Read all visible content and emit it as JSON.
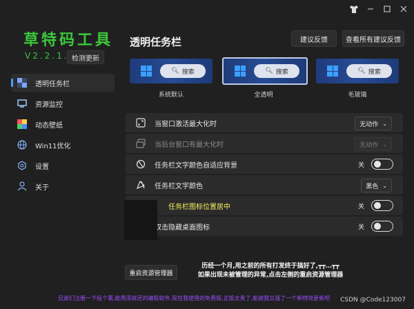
{
  "app": {
    "title": "草特码工具",
    "version": "V2.2.1.0",
    "update_button": "检测更新"
  },
  "sidebar": {
    "items": [
      {
        "label": "透明任务栏",
        "icon": "checker-icon",
        "active": true
      },
      {
        "label": "资源监控",
        "icon": "monitor-icon",
        "active": false
      },
      {
        "label": "动态壁纸",
        "icon": "wallpaper-icon",
        "active": false
      },
      {
        "label": "Win11优化",
        "icon": "globe-icon",
        "active": false
      },
      {
        "label": "设置",
        "icon": "gear-icon",
        "active": false
      },
      {
        "label": "关于",
        "icon": "user-icon",
        "active": false
      }
    ]
  },
  "header": {
    "page_title": "透明任务栏",
    "feedback_button": "建议反馈",
    "view_feedback_button": "查看所有建议反馈"
  },
  "previews": [
    {
      "label": "系统默认",
      "search": "搜索",
      "selected": false
    },
    {
      "label": "全透明",
      "search": "搜索",
      "selected": true
    },
    {
      "label": "毛玻璃",
      "search": "搜索",
      "selected": false
    }
  ],
  "settings": [
    {
      "label": "当窗口激活最大化时",
      "control": "dropdown",
      "value": "无动作",
      "disabled": false
    },
    {
      "label": "当后台窗口有最大化时",
      "control": "dropdown",
      "value": "无动作",
      "disabled": true
    },
    {
      "label": "任务栏文字颜色自适应背景",
      "control": "toggle",
      "value": "关",
      "disabled": false
    },
    {
      "label": "任务栏文字颜色",
      "control": "dropdown",
      "value": "黑色",
      "disabled": false
    },
    {
      "label": "任务栏图标位置居中",
      "control": "toggle",
      "value": "关",
      "disabled": false
    },
    {
      "label": "双击隐藏桌面图标",
      "control": "toggle",
      "value": "关",
      "disabled": false
    }
  ],
  "footer": {
    "restart_button": "重启资源管理器",
    "notice_line1": "历经一个月,用之前的所有打发终于搞好了,┳┳…┳┳",
    "notice_line2": "如果出现未被管理的异常,点击左侧的重启资源管理器",
    "marquee": "兄弟们注册一下投个票,能用添就还的编程软件,现在我使用的免费版,正版太贵了,能被我又强了一个新特效更新吧",
    "watermark": "CSDN @Code123007"
  },
  "colors": {
    "accent_green": "#3cc83c",
    "accent_blue": "#4aa3ff",
    "marquee_purple": "#9b4dff"
  }
}
